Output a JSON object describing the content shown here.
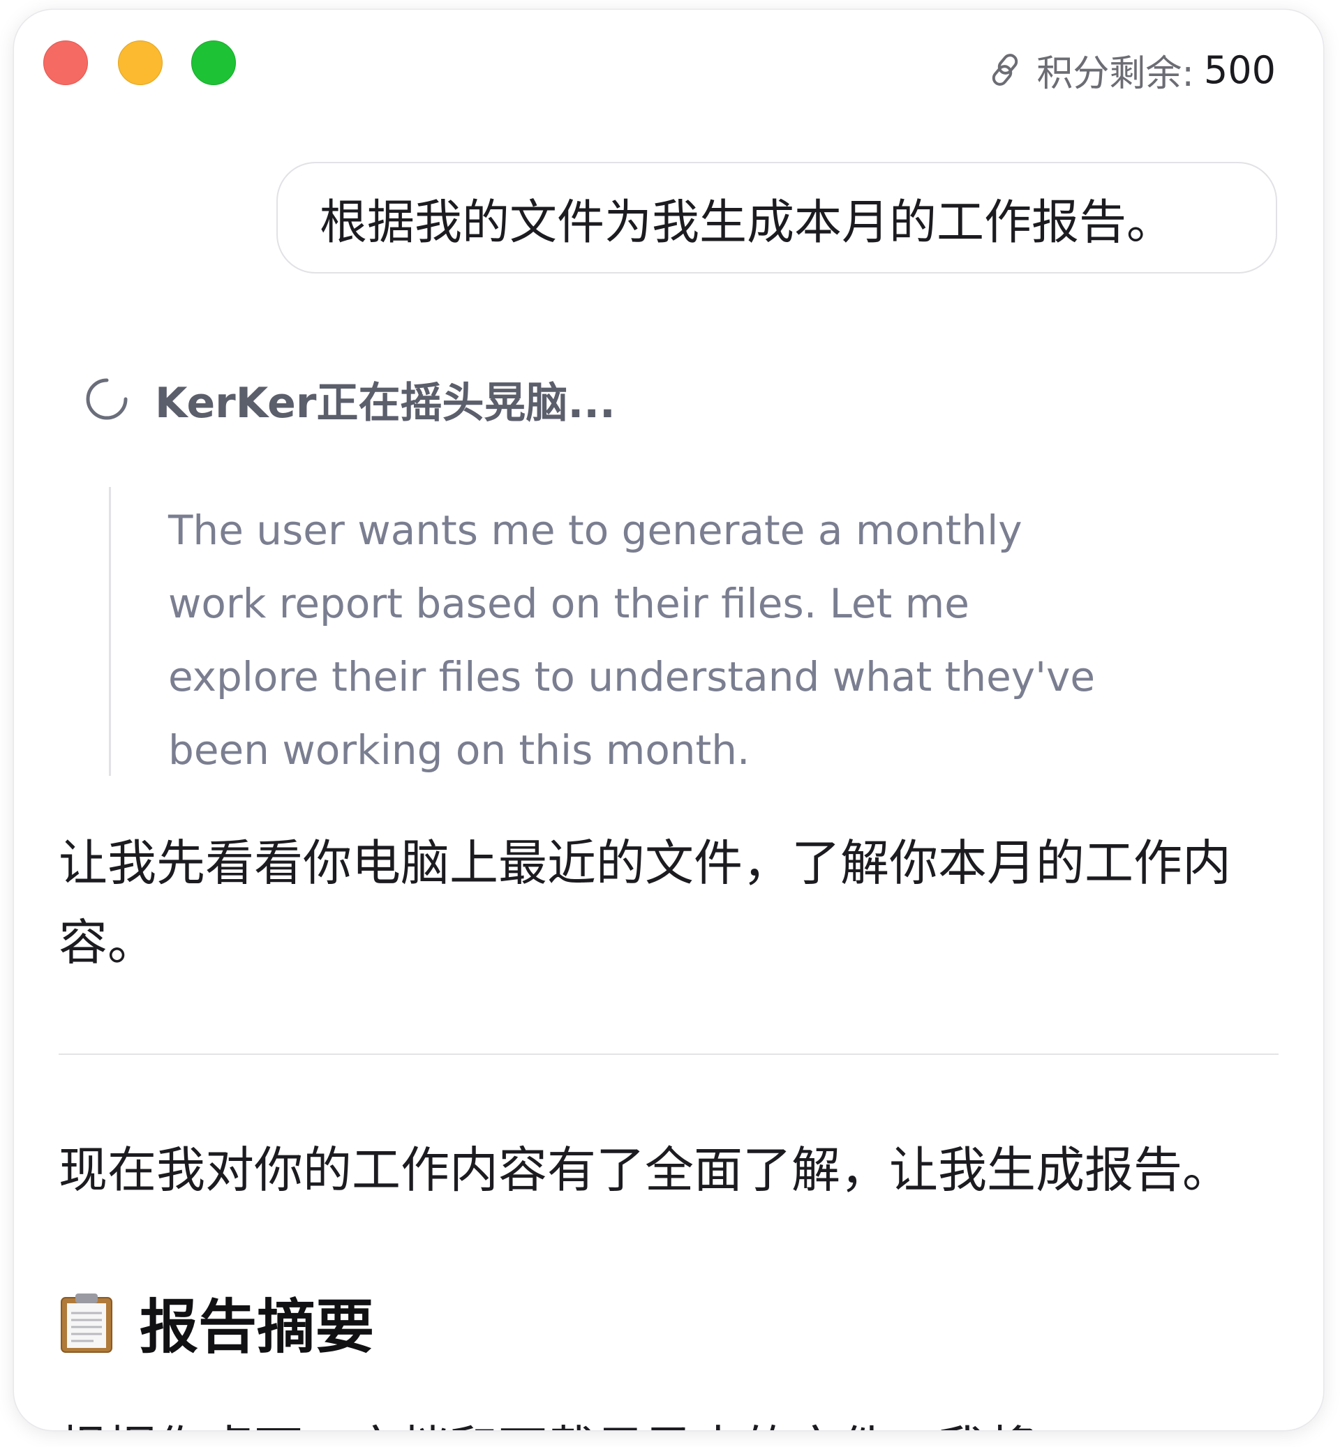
{
  "window": {
    "traffic_lights": {
      "close_color": "#f56a63",
      "minimize_color": "#fbba2f",
      "maximize_color": "#1ec235"
    }
  },
  "header": {
    "credits_icon": "link-icon",
    "credits_label": "积分剩余:",
    "credits_value": "500"
  },
  "chat": {
    "user_message": "根据我的文件为我生成本月的工作报告。",
    "thinking": {
      "icon": "spinner-icon",
      "label": "KerKer正在摇头晃脑..."
    },
    "reasoning_text": "The user wants me to generate a monthly work report based on their files. Let me explore their files to understand what they've been working on this month.",
    "assistant_message_1": "让我先看看你电脑上最近的文件，了解你本月的工作内容。",
    "assistant_message_2": "现在我对你的工作内容有了全面了解，让我生成报告。",
    "report_heading": {
      "icon": "clipboard-icon",
      "title": "报告摘要"
    },
    "partial_line": "根据你桌面、文档和下载目录中的文件，我将"
  },
  "colors": {
    "reasoning_text": "#7a7e90",
    "thinking_label": "#5b5e6b",
    "body_text": "#1c1c20"
  }
}
